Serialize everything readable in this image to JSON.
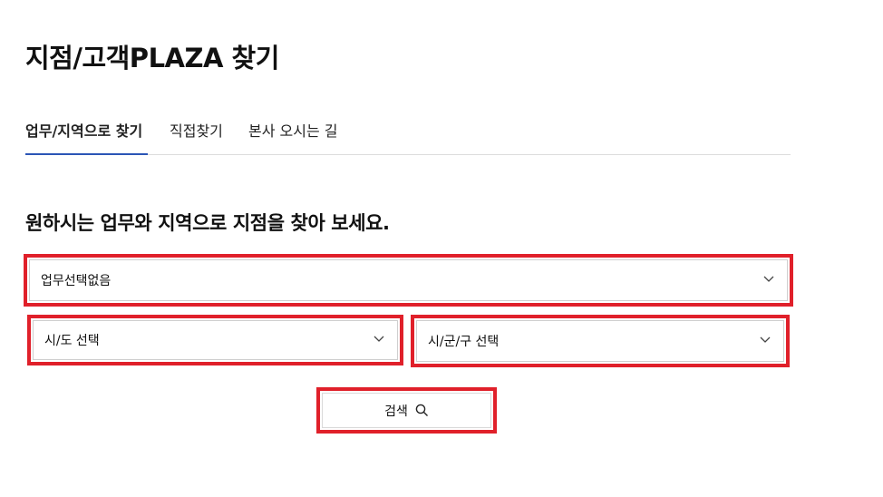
{
  "page": {
    "title": "지점/고객PLAZA 찾기"
  },
  "tabs": [
    {
      "label": "업무/지역으로 찾기",
      "active": true
    },
    {
      "label": "직접찾기",
      "active": false
    },
    {
      "label": "본사 오시는 길",
      "active": false
    }
  ],
  "search_form": {
    "heading": "원하시는 업무와 지역으로 지점을 찾아 보세요.",
    "business_select": {
      "selected": "업무선택없음"
    },
    "city_select": {
      "selected": "시/도 선택"
    },
    "district_select": {
      "selected": "시/군/구 선택"
    },
    "search_button": {
      "label": "검색",
      "icon": "search-icon"
    }
  },
  "colors": {
    "active_tab_underline": "#2b56b6",
    "highlight_border": "#e0202a",
    "divider": "#dcdcdc"
  }
}
